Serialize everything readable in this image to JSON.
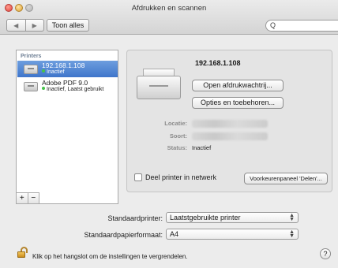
{
  "window": {
    "title": "Afdrukken en scannen"
  },
  "toolbar": {
    "back_icon": "◀",
    "forward_icon": "▶",
    "show_all_label": "Toon alles",
    "search_placeholder": "",
    "search_icon": "Q"
  },
  "printers": {
    "header": "Printers",
    "items": [
      {
        "name": "192.168.1.108",
        "status": "Inactief",
        "selected": true
      },
      {
        "name": "Adobe PDF 9.0",
        "status": "Inactief, Laatst gebruikt",
        "selected": false
      }
    ],
    "add_label": "+",
    "remove_label": "−"
  },
  "detail": {
    "name": "192.168.1.108",
    "open_queue_label": "Open afdrukwachtrij...",
    "options_label": "Opties en toebehoren...",
    "location_label": "Locatie:",
    "kind_label": "Soort:",
    "status_label": "Status:",
    "status_value": "Inactief",
    "share_label": "Deel printer in netwerk",
    "sharing_prefs_label": "Voorkeurenpaneel 'Delen'..."
  },
  "prefs": {
    "default_printer_label": "Standaardprinter:",
    "default_printer_value": "Laatstgebruikte printer",
    "default_paper_label": "Standaardpapierformaat:",
    "default_paper_value": "A4"
  },
  "footer": {
    "lock_text": "Klik op het hangslot om de instellingen te vergrendelen.",
    "help_label": "?"
  },
  "colors": {
    "selection": "#4a7fd0",
    "status_green": "#46c34a"
  }
}
